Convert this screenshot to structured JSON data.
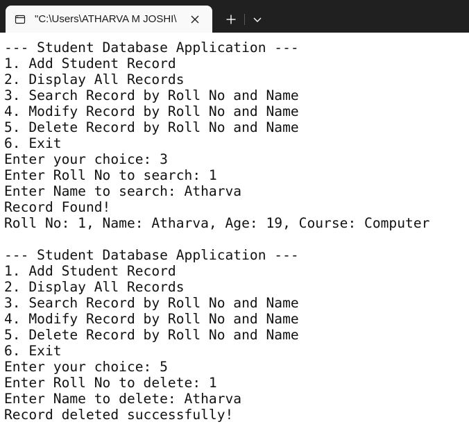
{
  "tab": {
    "title": "\"C:\\Users\\ATHARVA M JOSHI\\"
  },
  "console": {
    "lines": [
      "--- Student Database Application ---",
      "1. Add Student Record",
      "2. Display All Records",
      "3. Search Record by Roll No and Name",
      "4. Modify Record by Roll No and Name",
      "5. Delete Record by Roll No and Name",
      "6. Exit",
      "Enter your choice: 3",
      "Enter Roll No to search: 1",
      "Enter Name to search: Atharva",
      "Record Found!",
      "Roll No: 1, Name: Atharva, Age: 19, Course: Computer",
      "",
      "--- Student Database Application ---",
      "1. Add Student Record",
      "2. Display All Records",
      "3. Search Record by Roll No and Name",
      "4. Modify Record by Roll No and Name",
      "5. Delete Record by Roll No and Name",
      "6. Exit",
      "Enter your choice: 5",
      "Enter Roll No to delete: 1",
      "Enter Name to delete: Atharva",
      "Record deleted successfully!"
    ]
  },
  "colors": {
    "titlebar_bg": "#202020",
    "active_tab_bg": "#f9f9f9",
    "console_bg": "#ffffff",
    "console_text": "#111111"
  },
  "icons": {
    "tab_icon": "terminal-icon",
    "close": "close-icon",
    "new_tab": "plus-icon",
    "dropdown": "chevron-down-icon"
  }
}
